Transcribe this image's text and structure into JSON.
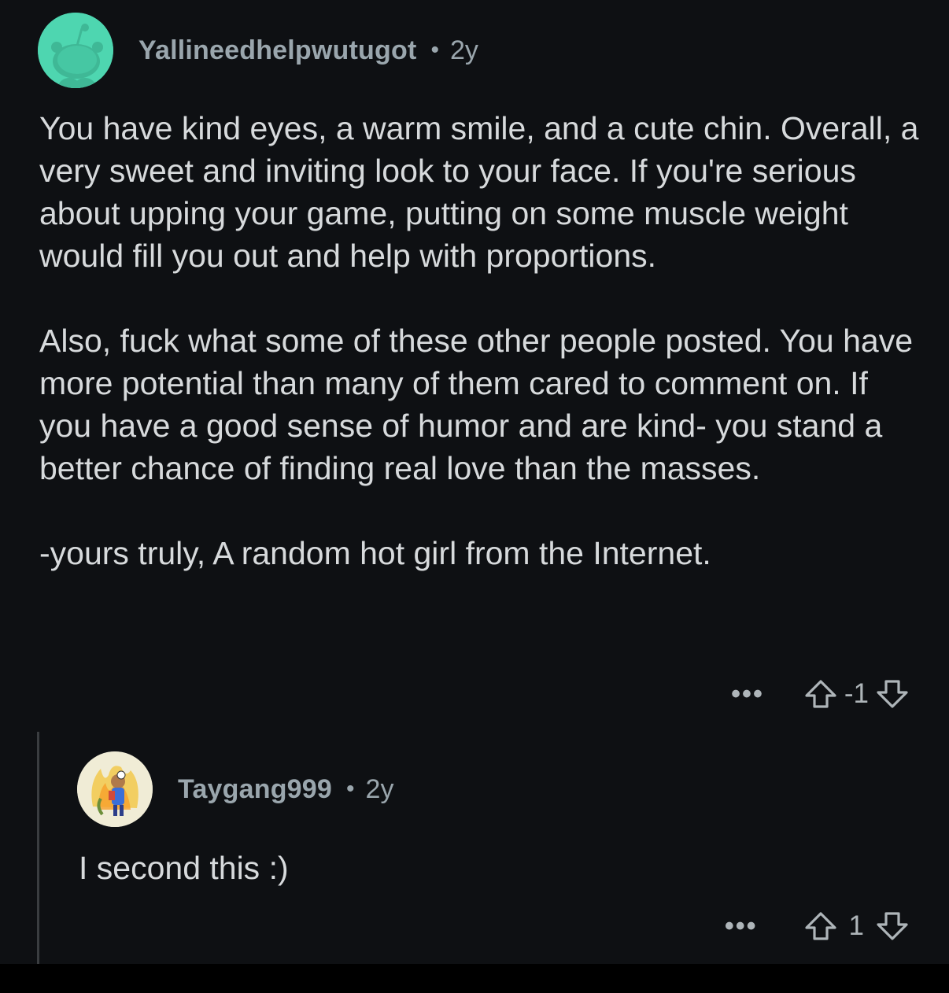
{
  "comments": [
    {
      "username": "Yallineedhelpwutugot",
      "separator": "•",
      "age": "2y",
      "paragraphs": [
        "You have kind eyes, a warm smile, and a cute chin. Overall, a very sweet and inviting look to your face.  If you're serious about upping your game, putting on some muscle weight would fill you out and help with proportions.",
        "Also, fuck what some of these other people posted. You have more potential than many of them cared to comment on. If you have a good sense of humor and are kind- you stand a better chance of finding real love than the masses.",
        "-yours truly, A random hot girl from the Internet."
      ],
      "more_label": "•••",
      "score": "-1"
    },
    {
      "username": "Taygang999",
      "separator": "•",
      "age": "2y",
      "paragraphs": [
        "I second this :)"
      ],
      "more_label": "•••",
      "score": "1"
    }
  ],
  "colors": {
    "background": "#0e1013",
    "text": "#d7dadc",
    "meta": "#9aa6ad",
    "avatar_bg": "#4ed6b0"
  },
  "icons": {
    "avatar1": "reddit-snoo-avatar",
    "avatar2": "cartoon-avatar",
    "upvote": "upvote-arrow-icon",
    "downvote": "downvote-arrow-icon",
    "more": "more-options-icon"
  }
}
